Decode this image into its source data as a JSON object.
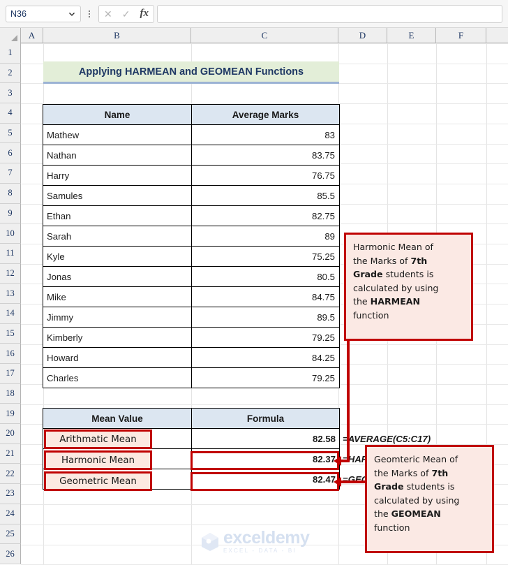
{
  "app": {
    "name_box_value": "N36",
    "formula_bar_value": "",
    "icons": {
      "chevron": "chevron-down-icon",
      "kebab": "more-options-icon",
      "cancel": "cancel-icon",
      "enter": "enter-icon",
      "fx": "insert-function-icon"
    }
  },
  "grid": {
    "columns": [
      "A",
      "B",
      "C",
      "D",
      "E",
      "F"
    ],
    "rows": [
      1,
      2,
      3,
      4,
      5,
      6,
      7,
      8,
      9,
      10,
      11,
      12,
      13,
      14,
      15,
      16,
      17,
      18,
      19,
      20,
      21,
      22,
      23,
      24,
      25,
      26
    ]
  },
  "sheet": {
    "title": "Applying HARMEAN and GEOMEAN Functions",
    "marks_table": {
      "headers": [
        "Name",
        "Average Marks"
      ],
      "rows": [
        {
          "name": "Mathew",
          "marks": "83"
        },
        {
          "name": "Nathan",
          "marks": "83.75"
        },
        {
          "name": "Harry",
          "marks": "76.75"
        },
        {
          "name": "Samules",
          "marks": "85.5"
        },
        {
          "name": "Ethan",
          "marks": "82.75"
        },
        {
          "name": "Sarah",
          "marks": "89"
        },
        {
          "name": "Kyle",
          "marks": "75.25"
        },
        {
          "name": "Jonas",
          "marks": "80.5"
        },
        {
          "name": "Mike",
          "marks": "84.75"
        },
        {
          "name": "Jimmy",
          "marks": "89.5"
        },
        {
          "name": "Kimberly",
          "marks": "79.25"
        },
        {
          "name": "Howard",
          "marks": "84.25"
        },
        {
          "name": "Charles",
          "marks": "79.25"
        }
      ]
    },
    "mean_table": {
      "headers": [
        "Mean Value",
        "Formula"
      ],
      "rows": [
        {
          "label": "Arithmatic Mean",
          "value": "82.58",
          "formula": "=AVERAGE(C5:C17)"
        },
        {
          "label": "Harmonic Mean",
          "value": "82.37",
          "formula": "=HARMEAN(C5:C17)"
        },
        {
          "label": "Geometric Mean",
          "value": "82.47",
          "formula": "=GEOMEAN(C5:C17)"
        }
      ]
    }
  },
  "callouts": [
    {
      "id": "harmean-callout",
      "line1": "Harmonic Mean of",
      "line2_pre": "the Marks of ",
      "line2_bold": "7th",
      "line3_bold": "Grade",
      "line3_post": " students is",
      "line4": "calculated by using",
      "line5_pre": "the ",
      "line5_bold": "HARMEAN",
      "line6": "function"
    },
    {
      "id": "geomean-callout",
      "line1": "Geomteric Mean of",
      "line2_pre": "the Marks of ",
      "line2_bold": "7th",
      "line3_bold": "Grade",
      "line3_post": " students is",
      "line4": "calculated by using",
      "line5_pre": "the ",
      "line5_bold": "GEOMEAN",
      "line6": "function"
    }
  ],
  "watermark": {
    "name": "exceldemy",
    "tagline": "EXCEL - DATA - BI"
  },
  "colors": {
    "header_fill": "#dce6f1",
    "title_fill": "#e3eed8",
    "title_text": "#1f3864",
    "callout_border": "#c00000",
    "callout_fill": "#fbe9e4",
    "formula_text": "#c55a11"
  }
}
